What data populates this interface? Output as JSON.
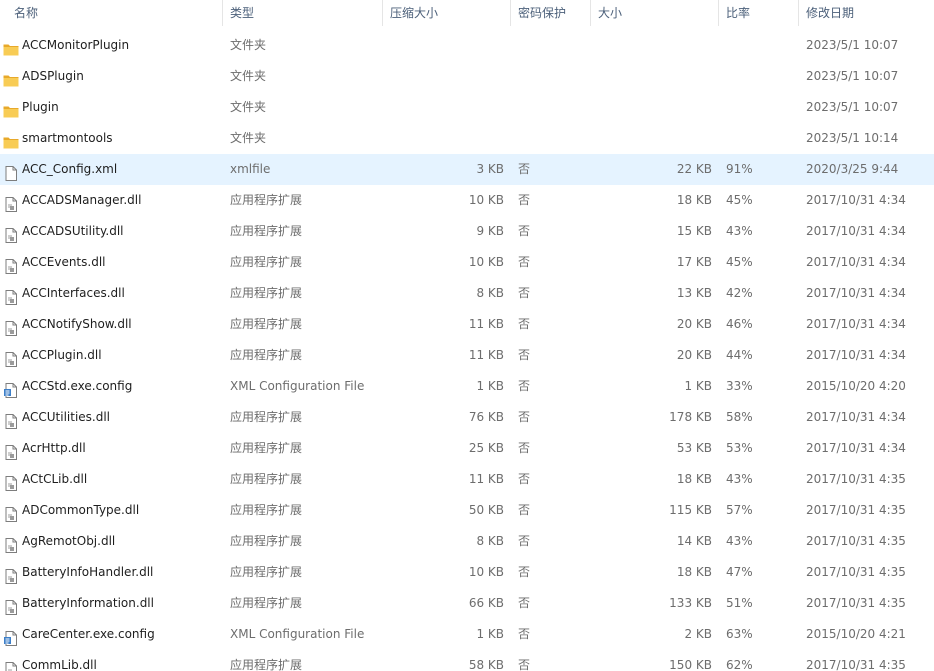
{
  "columns": {
    "name": "名称",
    "type": "类型",
    "compressed": "压缩大小",
    "encrypted": "密码保护",
    "size": "大小",
    "ratio": "比率",
    "modified": "修改日期"
  },
  "files": [
    {
      "name": "ACCMonitorPlugin",
      "type": "文件夹",
      "compressed": "",
      "encrypted": "",
      "size": "",
      "ratio": "",
      "modified": "2023/5/1 10:07",
      "icon": "folder-icon"
    },
    {
      "name": "ADSPlugin",
      "type": "文件夹",
      "compressed": "",
      "encrypted": "",
      "size": "",
      "ratio": "",
      "modified": "2023/5/1 10:07",
      "icon": "folder-icon"
    },
    {
      "name": "Plugin",
      "type": "文件夹",
      "compressed": "",
      "encrypted": "",
      "size": "",
      "ratio": "",
      "modified": "2023/5/1 10:07",
      "icon": "folder-icon"
    },
    {
      "name": "smartmontools",
      "type": "文件夹",
      "compressed": "",
      "encrypted": "",
      "size": "",
      "ratio": "",
      "modified": "2023/5/1 10:14",
      "icon": "folder-icon"
    },
    {
      "name": "ACC_Config.xml",
      "type": "xmlfile",
      "compressed": "3 KB",
      "encrypted": "否",
      "size": "22 KB",
      "ratio": "91%",
      "modified": "2020/3/25 9:44",
      "icon": "blank-file-icon",
      "selected": true
    },
    {
      "name": "ACCADSManager.dll",
      "type": "应用程序扩展",
      "compressed": "10 KB",
      "encrypted": "否",
      "size": "18 KB",
      "ratio": "45%",
      "modified": "2017/10/31 4:34",
      "icon": "dll-file-icon"
    },
    {
      "name": "ACCADSUtility.dll",
      "type": "应用程序扩展",
      "compressed": "9 KB",
      "encrypted": "否",
      "size": "15 KB",
      "ratio": "43%",
      "modified": "2017/10/31 4:34",
      "icon": "dll-file-icon"
    },
    {
      "name": "ACCEvents.dll",
      "type": "应用程序扩展",
      "compressed": "10 KB",
      "encrypted": "否",
      "size": "17 KB",
      "ratio": "45%",
      "modified": "2017/10/31 4:34",
      "icon": "dll-file-icon"
    },
    {
      "name": "ACCInterfaces.dll",
      "type": "应用程序扩展",
      "compressed": "8 KB",
      "encrypted": "否",
      "size": "13 KB",
      "ratio": "42%",
      "modified": "2017/10/31 4:34",
      "icon": "dll-file-icon"
    },
    {
      "name": "ACCNotifyShow.dll",
      "type": "应用程序扩展",
      "compressed": "11 KB",
      "encrypted": "否",
      "size": "20 KB",
      "ratio": "46%",
      "modified": "2017/10/31 4:34",
      "icon": "dll-file-icon"
    },
    {
      "name": "ACCPlugin.dll",
      "type": "应用程序扩展",
      "compressed": "11 KB",
      "encrypted": "否",
      "size": "20 KB",
      "ratio": "44%",
      "modified": "2017/10/31 4:34",
      "icon": "dll-file-icon"
    },
    {
      "name": "ACCStd.exe.config",
      "type": "XML Configuration File",
      "compressed": "1 KB",
      "encrypted": "否",
      "size": "1 KB",
      "ratio": "33%",
      "modified": "2015/10/20 4:20",
      "icon": "config-file-icon"
    },
    {
      "name": "ACCUtilities.dll",
      "type": "应用程序扩展",
      "compressed": "76 KB",
      "encrypted": "否",
      "size": "178 KB",
      "ratio": "58%",
      "modified": "2017/10/31 4:34",
      "icon": "dll-file-icon"
    },
    {
      "name": "AcrHttp.dll",
      "type": "应用程序扩展",
      "compressed": "25 KB",
      "encrypted": "否",
      "size": "53 KB",
      "ratio": "53%",
      "modified": "2017/10/31 4:34",
      "icon": "dll-file-icon"
    },
    {
      "name": "ACtCLib.dll",
      "type": "应用程序扩展",
      "compressed": "11 KB",
      "encrypted": "否",
      "size": "18 KB",
      "ratio": "43%",
      "modified": "2017/10/31 4:35",
      "icon": "dll-file-icon"
    },
    {
      "name": "ADCommonType.dll",
      "type": "应用程序扩展",
      "compressed": "50 KB",
      "encrypted": "否",
      "size": "115 KB",
      "ratio": "57%",
      "modified": "2017/10/31 4:35",
      "icon": "dll-file-icon"
    },
    {
      "name": "AgRemotObj.dll",
      "type": "应用程序扩展",
      "compressed": "8 KB",
      "encrypted": "否",
      "size": "14 KB",
      "ratio": "43%",
      "modified": "2017/10/31 4:35",
      "icon": "dll-file-icon"
    },
    {
      "name": "BatteryInfoHandler.dll",
      "type": "应用程序扩展",
      "compressed": "10 KB",
      "encrypted": "否",
      "size": "18 KB",
      "ratio": "47%",
      "modified": "2017/10/31 4:35",
      "icon": "dll-file-icon"
    },
    {
      "name": "BatteryInformation.dll",
      "type": "应用程序扩展",
      "compressed": "66 KB",
      "encrypted": "否",
      "size": "133 KB",
      "ratio": "51%",
      "modified": "2017/10/31 4:35",
      "icon": "dll-file-icon"
    },
    {
      "name": "CareCenter.exe.config",
      "type": "XML Configuration File",
      "compressed": "1 KB",
      "encrypted": "否",
      "size": "2 KB",
      "ratio": "63%",
      "modified": "2015/10/20 4:21",
      "icon": "config-file-icon"
    },
    {
      "name": "CommLib.dll",
      "type": "应用程序扩展",
      "compressed": "58 KB",
      "encrypted": "否",
      "size": "150 KB",
      "ratio": "62%",
      "modified": "2017/10/31 4:35",
      "icon": "dll-file-icon"
    }
  ],
  "colors": {
    "selected_row": "#e5f3ff",
    "header_text": "#4c607a",
    "folder": "#f5c342"
  }
}
